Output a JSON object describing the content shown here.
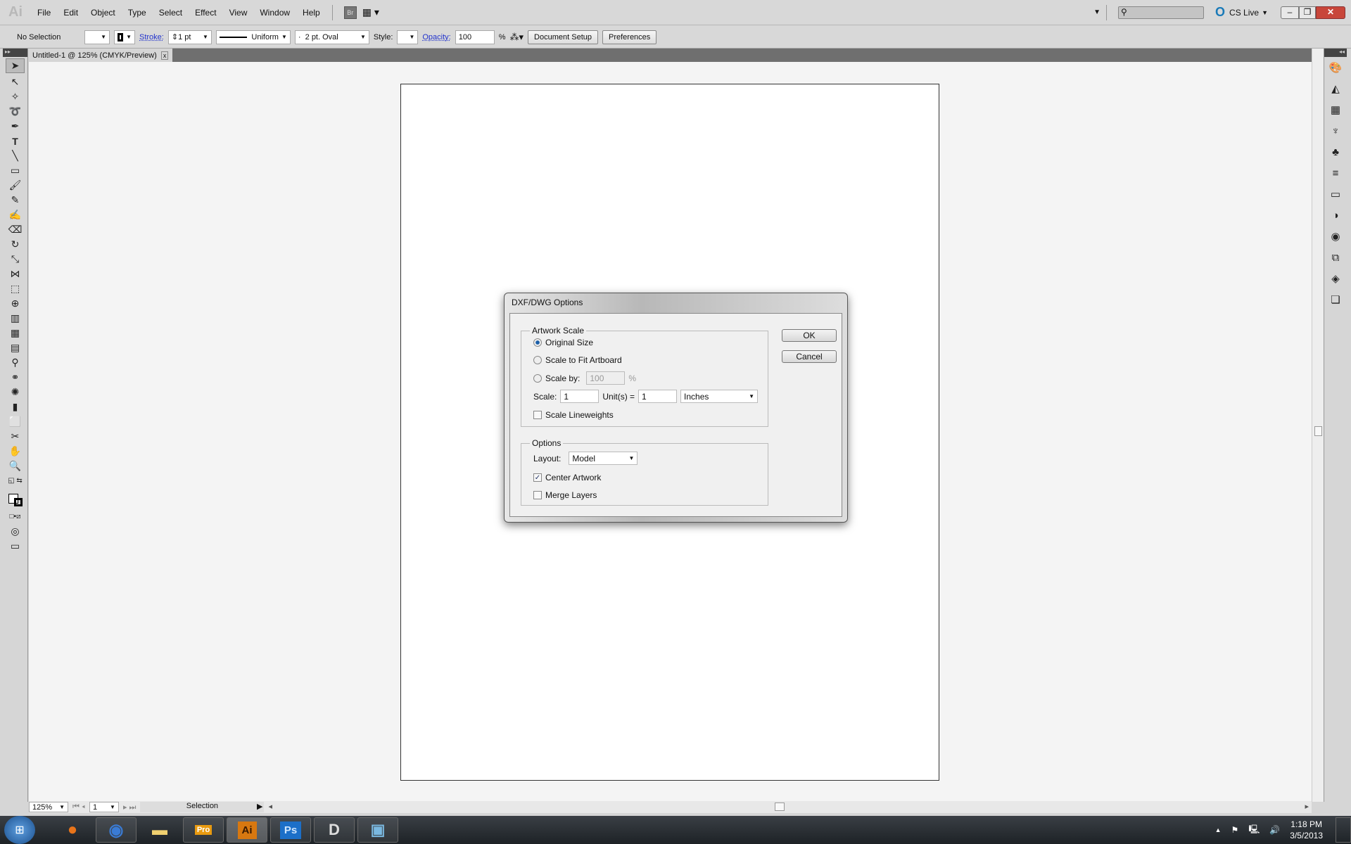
{
  "app": {
    "logo": "Ai",
    "menus": [
      "File",
      "Edit",
      "Object",
      "Type",
      "Select",
      "Effect",
      "View",
      "Window",
      "Help"
    ],
    "bridge": "Br",
    "cs_live": "CS Live",
    "search_placeholder": ""
  },
  "control": {
    "selection": "No Selection",
    "stroke_label": "Stroke:",
    "stroke_value": "1 pt",
    "profile": "Uniform",
    "brush": "2 pt. Oval",
    "style_label": "Style:",
    "opacity_label": "Opacity:",
    "opacity_value": "100",
    "percent": "%",
    "document_setup": "Document Setup",
    "preferences": "Preferences"
  },
  "document": {
    "tab_title": "Untitled-1 @ 125% (CMYK/Preview)",
    "close": "x"
  },
  "status": {
    "zoom": "125%",
    "artboard": "1",
    "tool": "Selection"
  },
  "dialog": {
    "title": "DXF/DWG Options",
    "artwork_scale": "Artwork Scale",
    "original_size": "Original Size",
    "scale_to_fit": "Scale to Fit Artboard",
    "scale_by": "Scale by:",
    "scale_by_value": "100",
    "percent": "%",
    "scale_label": "Scale:",
    "scale_value": "1",
    "units_label": "Unit(s) =",
    "units_value": "1",
    "unit": "Inches",
    "scale_lineweights": "Scale Lineweights",
    "scale_lineweights_checked": false,
    "options": "Options",
    "layout_label": "Layout:",
    "layout_value": "Model",
    "center_artwork": "Center Artwork",
    "center_artwork_checked": true,
    "merge_layers": "Merge Layers",
    "merge_layers_checked": false,
    "selected_scale_option": "Original Size",
    "ok": "OK",
    "cancel": "Cancel"
  },
  "taskbar": {
    "apps": [
      "Firefox",
      "Chrome",
      "Explorer",
      "Pro",
      "Ai",
      "Ps",
      "D",
      "Photos"
    ],
    "time": "1:18 PM",
    "date": "3/5/2013"
  },
  "colors": {
    "close_button": "#c8463a",
    "ai_icon": "#e8a020",
    "ps_icon": "#1c6fc8"
  }
}
